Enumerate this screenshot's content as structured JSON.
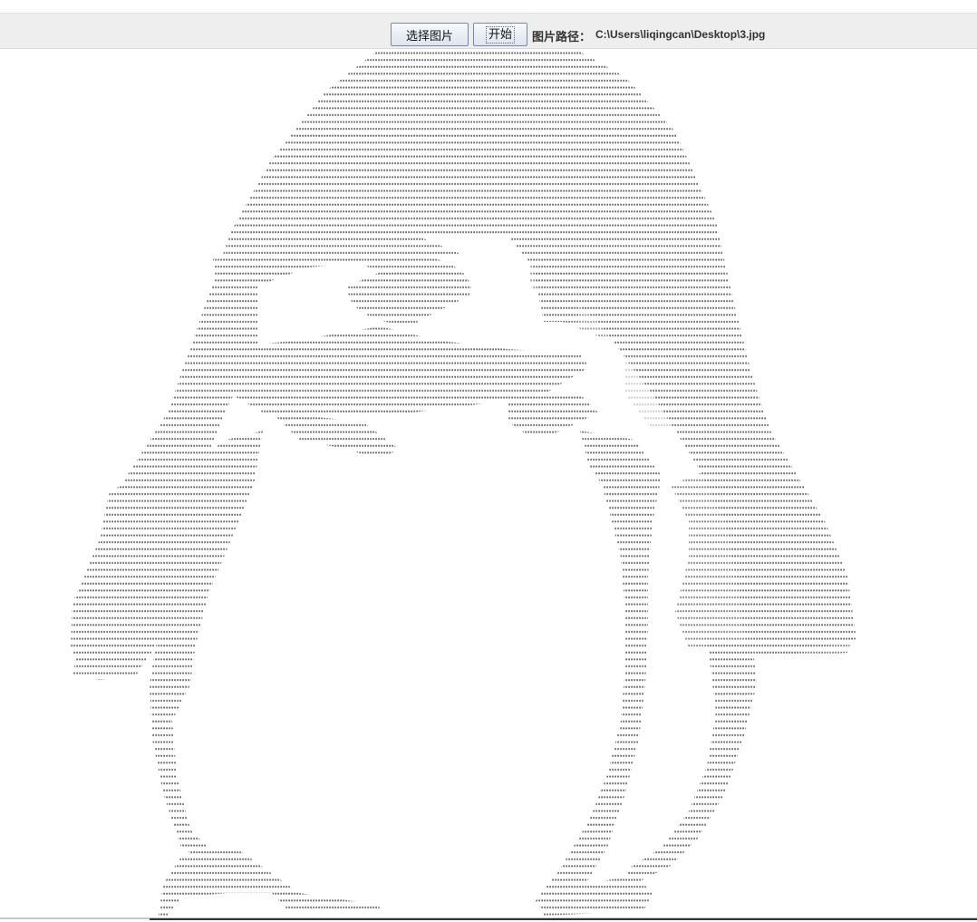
{
  "toolbar": {
    "select_image_label": "选择图片",
    "start_label": "开始",
    "path_label": "图片路径：",
    "path_value": "C:\\Users\\liqingcan\\Desktop\\3.jpg"
  },
  "art": {
    "glyph": "*",
    "color": "#555555"
  }
}
